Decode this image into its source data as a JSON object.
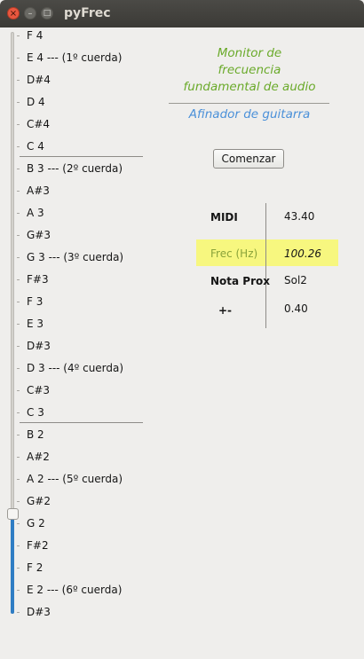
{
  "window": {
    "title": "pyFrec",
    "close_glyph": "×",
    "min_glyph": "–",
    "max_glyph": "□"
  },
  "notes": [
    "F 4",
    "E 4 --- (1º cuerda)",
    "D#4",
    "D 4",
    "C#4",
    "C 4",
    "B 3 --- (2º cuerda)",
    "A#3",
    "A 3",
    "G#3",
    "G 3  --- (3º cuerda)",
    "F#3",
    "F 3",
    "E 3",
    "D#3",
    "D 3  --- (4º cuerda)",
    "C#3",
    "C 3",
    "B 2",
    "A#2",
    "A 2   --- (5º cuerda)",
    "G#2",
    "G 2",
    "F#2",
    "F 2",
    "E 2  --- (6º cuerda)",
    "D#3"
  ],
  "header": {
    "line1": "Monitor de",
    "line2": "frecuencia",
    "line3": "fundamental de audio",
    "subtitle": "Afinador de guitarra",
    "header_color": "#6aaa2a",
    "subtitle_color": "#4a90d9"
  },
  "start_button": "Comenzar",
  "readouts": {
    "midi_label": "MIDI",
    "midi_value": "43.40",
    "freq_label": "Frec (Hz)",
    "freq_value": "100.26",
    "nota_label": "Nota Prox",
    "nota_value": "Sol2",
    "pm_label": "+-",
    "pm_value": "0.40",
    "highlight_color": "#f7f77f"
  },
  "slider": {
    "level_fraction": 0.16
  }
}
